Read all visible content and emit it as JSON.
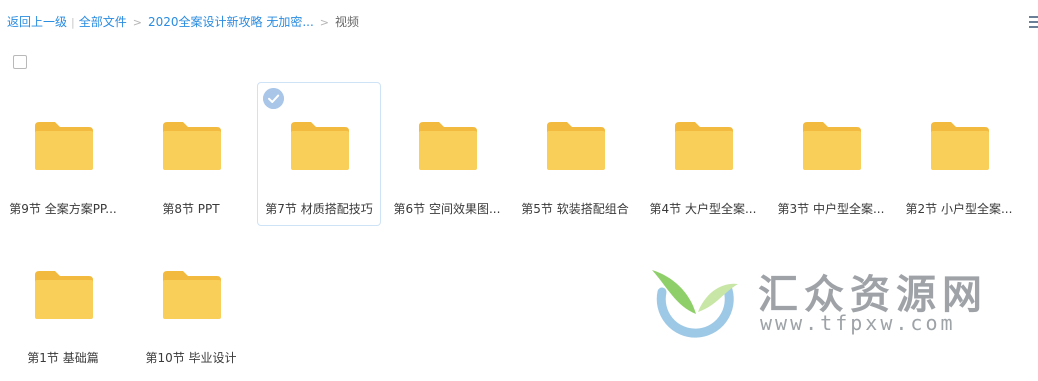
{
  "breadcrumb": {
    "back": "返回上一级",
    "root": "全部文件",
    "parent": "2020全案设计新攻略 无加密...",
    "current": "视频",
    "pipe": "|",
    "chevron": ">"
  },
  "icons": {
    "view": "list-view-icon",
    "folder": "folder-icon",
    "check": "check-circle-icon"
  },
  "colors": {
    "folder": "#f9cf5a",
    "folder_tab": "#f2bb3f",
    "link": "#2a8ce0",
    "selected_border": "#cfe3f6"
  },
  "folders": [
    {
      "name": "第9节 全案方案PP...",
      "selected": false
    },
    {
      "name": "第8节 PPT",
      "selected": false
    },
    {
      "name": "第7节 材质搭配技巧",
      "selected": true
    },
    {
      "name": "第6节 空间效果图...",
      "selected": false
    },
    {
      "name": "第5节 软装搭配组合",
      "selected": false
    },
    {
      "name": "第4节 大户型全案...",
      "selected": false
    },
    {
      "name": "第3节 中户型全案...",
      "selected": false
    },
    {
      "name": "第2节 小户型全案...",
      "selected": false
    },
    {
      "name": "第1节 基础篇",
      "selected": false
    },
    {
      "name": "第10节 毕业设计",
      "selected": false
    }
  ],
  "watermark": {
    "title": "汇众资源网",
    "url": "www.tfpxw.com"
  }
}
